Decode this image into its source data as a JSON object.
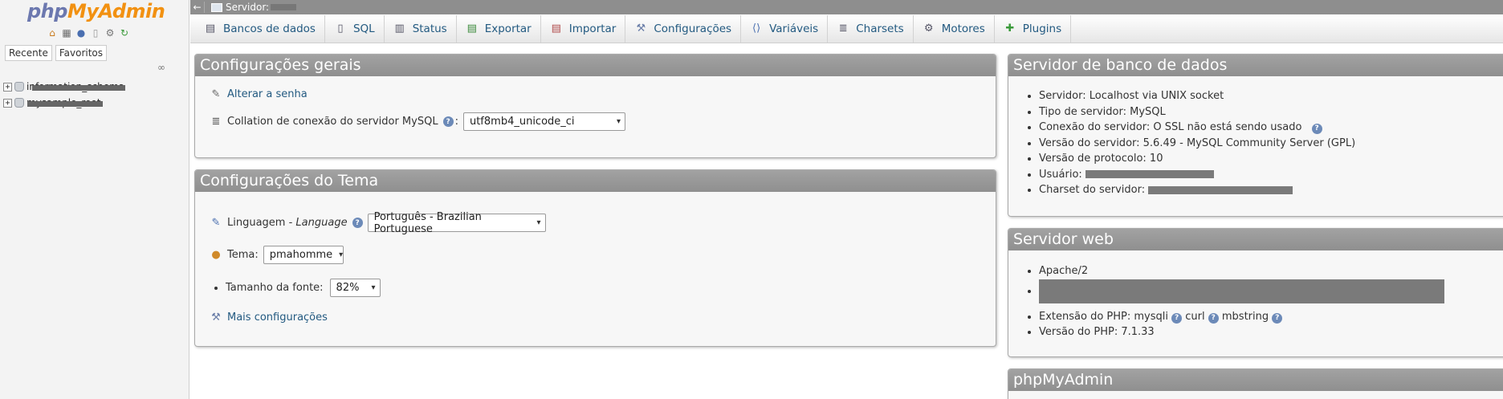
{
  "nav": {
    "logo": {
      "php": "php",
      "my": "My",
      "admin": "Admin"
    },
    "icons": [
      "home-icon",
      "sql-icon",
      "help-icon",
      "docs-icon",
      "settings-icon",
      "reload-icon"
    ],
    "tabs": [
      "Recente",
      "Favoritos"
    ],
    "link_icon": "chain-link-icon",
    "databases": [
      {
        "name": "information_schema"
      },
      {
        "name": "mysample_root"
      }
    ]
  },
  "topbar": {
    "crumb": "Servidor:"
  },
  "menu": [
    {
      "label": "Bancos de dados",
      "icon": "database-icon"
    },
    {
      "label": "SQL",
      "icon": "sql-icon"
    },
    {
      "label": "Status",
      "icon": "status-icon"
    },
    {
      "label": "Exportar",
      "icon": "export-icon"
    },
    {
      "label": "Importar",
      "icon": "import-icon"
    },
    {
      "label": "Configurações",
      "icon": "wrench-icon"
    },
    {
      "label": "Variáveis",
      "icon": "variables-icon"
    },
    {
      "label": "Charsets",
      "icon": "charsets-icon"
    },
    {
      "label": "Motores",
      "icon": "engines-icon"
    },
    {
      "label": "Plugins",
      "icon": "plugin-icon"
    }
  ],
  "general": {
    "title": "Configurações gerais",
    "change_password": "Alterar a senha",
    "collation_label": "Collation de conexão do servidor MySQL",
    "collation_value": "utf8mb4_unicode_ci"
  },
  "theme": {
    "title": "Configurações do Tema",
    "language_label": "Linguagem - ",
    "language_label_en": "Language",
    "language_value": "Português - Brazilian Portuguese",
    "theme_label": "Tema:",
    "theme_value": "pmahomme",
    "font_label": "Tamanho da fonte:",
    "font_value": "82%",
    "more_settings": "Mais configurações"
  },
  "db_server": {
    "title": "Servidor de banco de dados",
    "items": [
      "Servidor: Localhost via UNIX socket",
      "Tipo de servidor: MySQL",
      "Conexão do servidor: O SSL não está sendo usado",
      "Versão do servidor: 5.6.49 - MySQL Community Server (GPL)",
      "Versão de protocolo: 10",
      "Usuário:",
      "Charset do servidor:"
    ]
  },
  "web_server": {
    "title": "Servidor web",
    "apache": "Apache/2",
    "php_ext_label": "Extensão do PHP: mysqli",
    "php_ext_curl": "curl",
    "php_ext_mbstring": "mbstring",
    "php_version": "Versão do PHP: 7.1.33"
  },
  "pma_panel": {
    "title": "phpMyAdmin"
  }
}
